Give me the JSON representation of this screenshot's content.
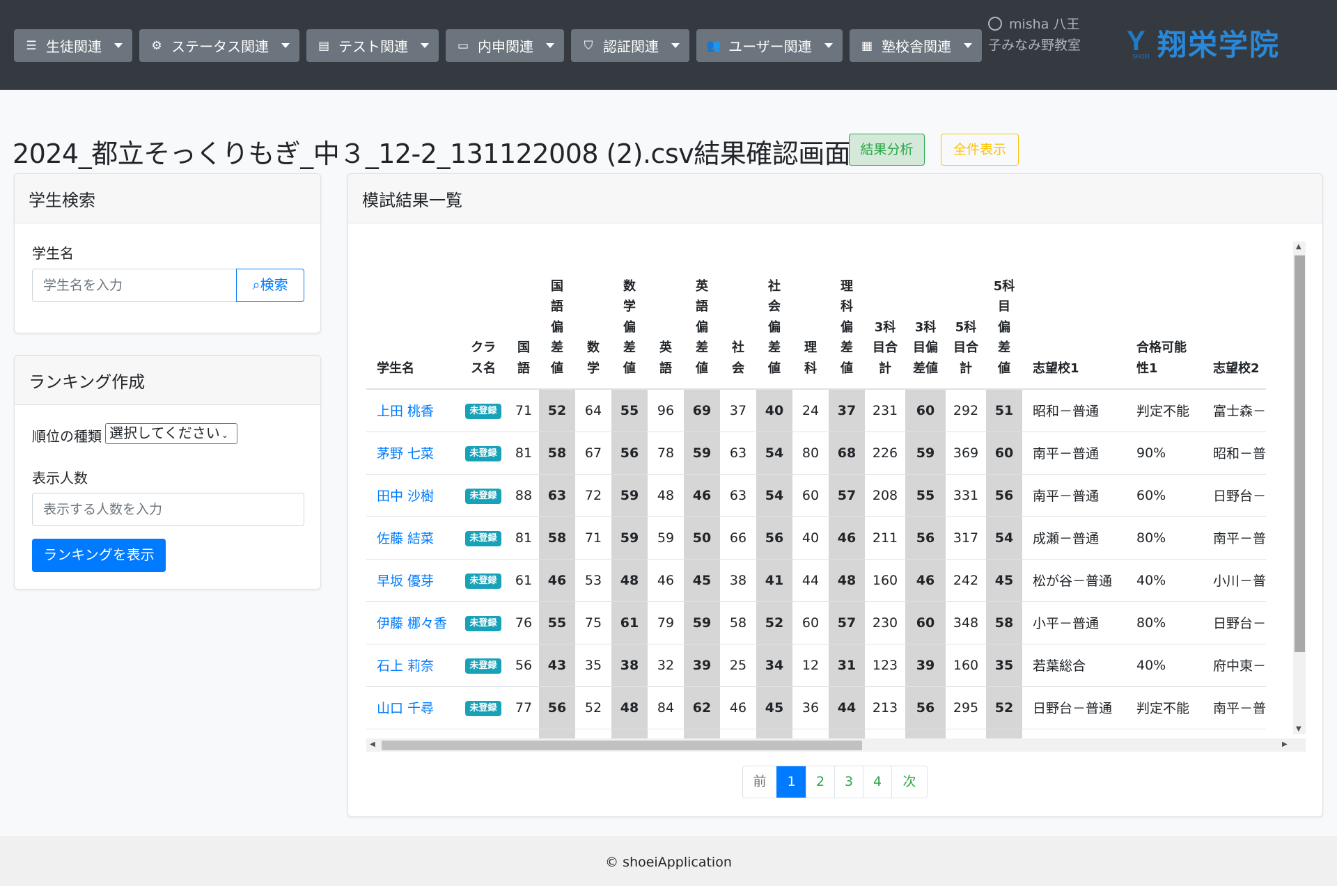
{
  "nav": {
    "items": [
      {
        "label": "生徒関連",
        "icon": "user-list-icon"
      },
      {
        "label": "ステータス関連",
        "icon": "gear-icon"
      },
      {
        "label": "テスト関連",
        "icon": "document-icon"
      },
      {
        "label": "内申関連",
        "icon": "id-card-icon"
      },
      {
        "label": "認証関連",
        "icon": "shield-icon"
      },
      {
        "label": "ユーザー関連",
        "icon": "users-icon"
      },
      {
        "label": "塾校舎関連",
        "icon": "building-icon"
      }
    ],
    "user": "misha 八王子みなみ野教室",
    "logo_text": "翔栄学院",
    "logo_sub": "SHOEI"
  },
  "page": {
    "title": "2024_都立そっくりもぎ_中３_12-2_131122008 (2).csv結果確認画面",
    "analysis_button": "結果分析",
    "show_all_button": "全件表示"
  },
  "search": {
    "title": "学生検索",
    "label": "学生名",
    "placeholder": "学生名を入力",
    "button": "検索"
  },
  "ranking": {
    "title": "ランキング作成",
    "type_label": "順位の種類",
    "type_selected": "選択してください",
    "count_label": "表示人数",
    "count_placeholder": "表示する人数を入力",
    "button": "ランキングを表示"
  },
  "results": {
    "title": "模試結果一覧",
    "columns": [
      "学生名",
      "クラス名",
      "国語",
      "国語偏差値",
      "数学",
      "数学偏差値",
      "英語",
      "英語偏差値",
      "社会",
      "社会偏差値",
      "理科",
      "理科偏差値",
      "3科目合計",
      "3科目偏差値",
      "5科目合計",
      "5科目偏差値",
      "志望校1",
      "合格可能性1",
      "志望校2"
    ],
    "rows": [
      [
        "上田 桃香",
        "未登録",
        "71",
        "52",
        "64",
        "55",
        "96",
        "69",
        "37",
        "40",
        "24",
        "37",
        "231",
        "60",
        "292",
        "51",
        "昭和－普通",
        "判定不能",
        "富士森－"
      ],
      [
        "茅野 七菜",
        "未登録",
        "81",
        "58",
        "67",
        "56",
        "78",
        "59",
        "63",
        "54",
        "80",
        "68",
        "226",
        "59",
        "369",
        "60",
        "南平－普通",
        "90%",
        "昭和－普"
      ],
      [
        "田中 沙樹",
        "未登録",
        "88",
        "63",
        "72",
        "59",
        "48",
        "46",
        "63",
        "54",
        "60",
        "57",
        "208",
        "55",
        "331",
        "56",
        "南平－普通",
        "60%",
        "日野台－"
      ],
      [
        "佐藤 結菜",
        "未登録",
        "81",
        "58",
        "71",
        "59",
        "59",
        "50",
        "66",
        "56",
        "40",
        "46",
        "211",
        "56",
        "317",
        "54",
        "成瀬－普通",
        "80%",
        "南平－普"
      ],
      [
        "早坂 優芽",
        "未登録",
        "61",
        "46",
        "53",
        "48",
        "46",
        "45",
        "38",
        "41",
        "44",
        "48",
        "160",
        "46",
        "242",
        "45",
        "松が谷－普通",
        "40%",
        "小川－普"
      ],
      [
        "伊藤 梛々香",
        "未登録",
        "76",
        "55",
        "75",
        "61",
        "79",
        "59",
        "58",
        "52",
        "60",
        "57",
        "230",
        "60",
        "348",
        "58",
        "小平－普通",
        "80%",
        "日野台－"
      ],
      [
        "石上 莉奈",
        "未登録",
        "56",
        "43",
        "35",
        "38",
        "32",
        "39",
        "25",
        "34",
        "12",
        "31",
        "123",
        "39",
        "160",
        "35",
        "若葉総合",
        "40%",
        "府中東－"
      ],
      [
        "山口 千尋",
        "未登録",
        "77",
        "56",
        "52",
        "48",
        "84",
        "62",
        "46",
        "45",
        "36",
        "44",
        "213",
        "56",
        "295",
        "52",
        "日野台－普通",
        "判定不能",
        "南平－普"
      ]
    ]
  },
  "pagination": {
    "prev": "前",
    "pages": [
      "1",
      "2",
      "3",
      "4"
    ],
    "current": "1",
    "next": "次"
  },
  "footer": "© shoeiApplication",
  "colors": {
    "navbar": "#343a40",
    "nav_button": "#6c757d",
    "primary": "#007bff",
    "success": "#28a745",
    "warning": "#ffc107",
    "badge": "#17a2b8",
    "deviation_cell": "#d6d6d6"
  }
}
